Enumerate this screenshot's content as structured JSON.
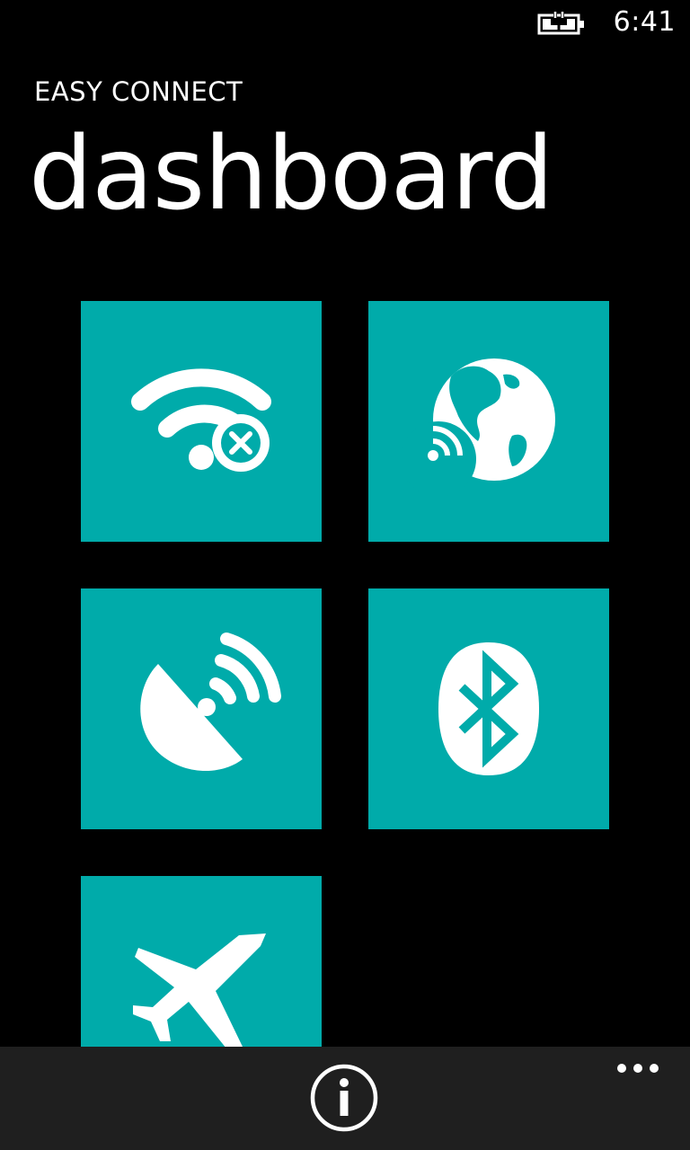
{
  "status_bar": {
    "time": "6:41",
    "battery_icon": "battery-charging-icon"
  },
  "header": {
    "app_title": "EASY CONNECT",
    "page_title": "dashboard"
  },
  "tiles": [
    {
      "id": "wifi",
      "icon": "wifi-off-icon",
      "state": "off"
    },
    {
      "id": "internet",
      "icon": "globe-signal-icon"
    },
    {
      "id": "cellular",
      "icon": "satellite-dish-icon"
    },
    {
      "id": "bluetooth",
      "icon": "bluetooth-icon"
    },
    {
      "id": "airplane",
      "icon": "airplane-icon"
    }
  ],
  "colors": {
    "background": "#000000",
    "tile": "#00abaa",
    "app_bar": "#1f1f1f",
    "foreground": "#ffffff"
  },
  "app_bar": {
    "buttons": [
      {
        "icon": "info-icon"
      }
    ],
    "more_icon": "ellipsis-icon"
  }
}
